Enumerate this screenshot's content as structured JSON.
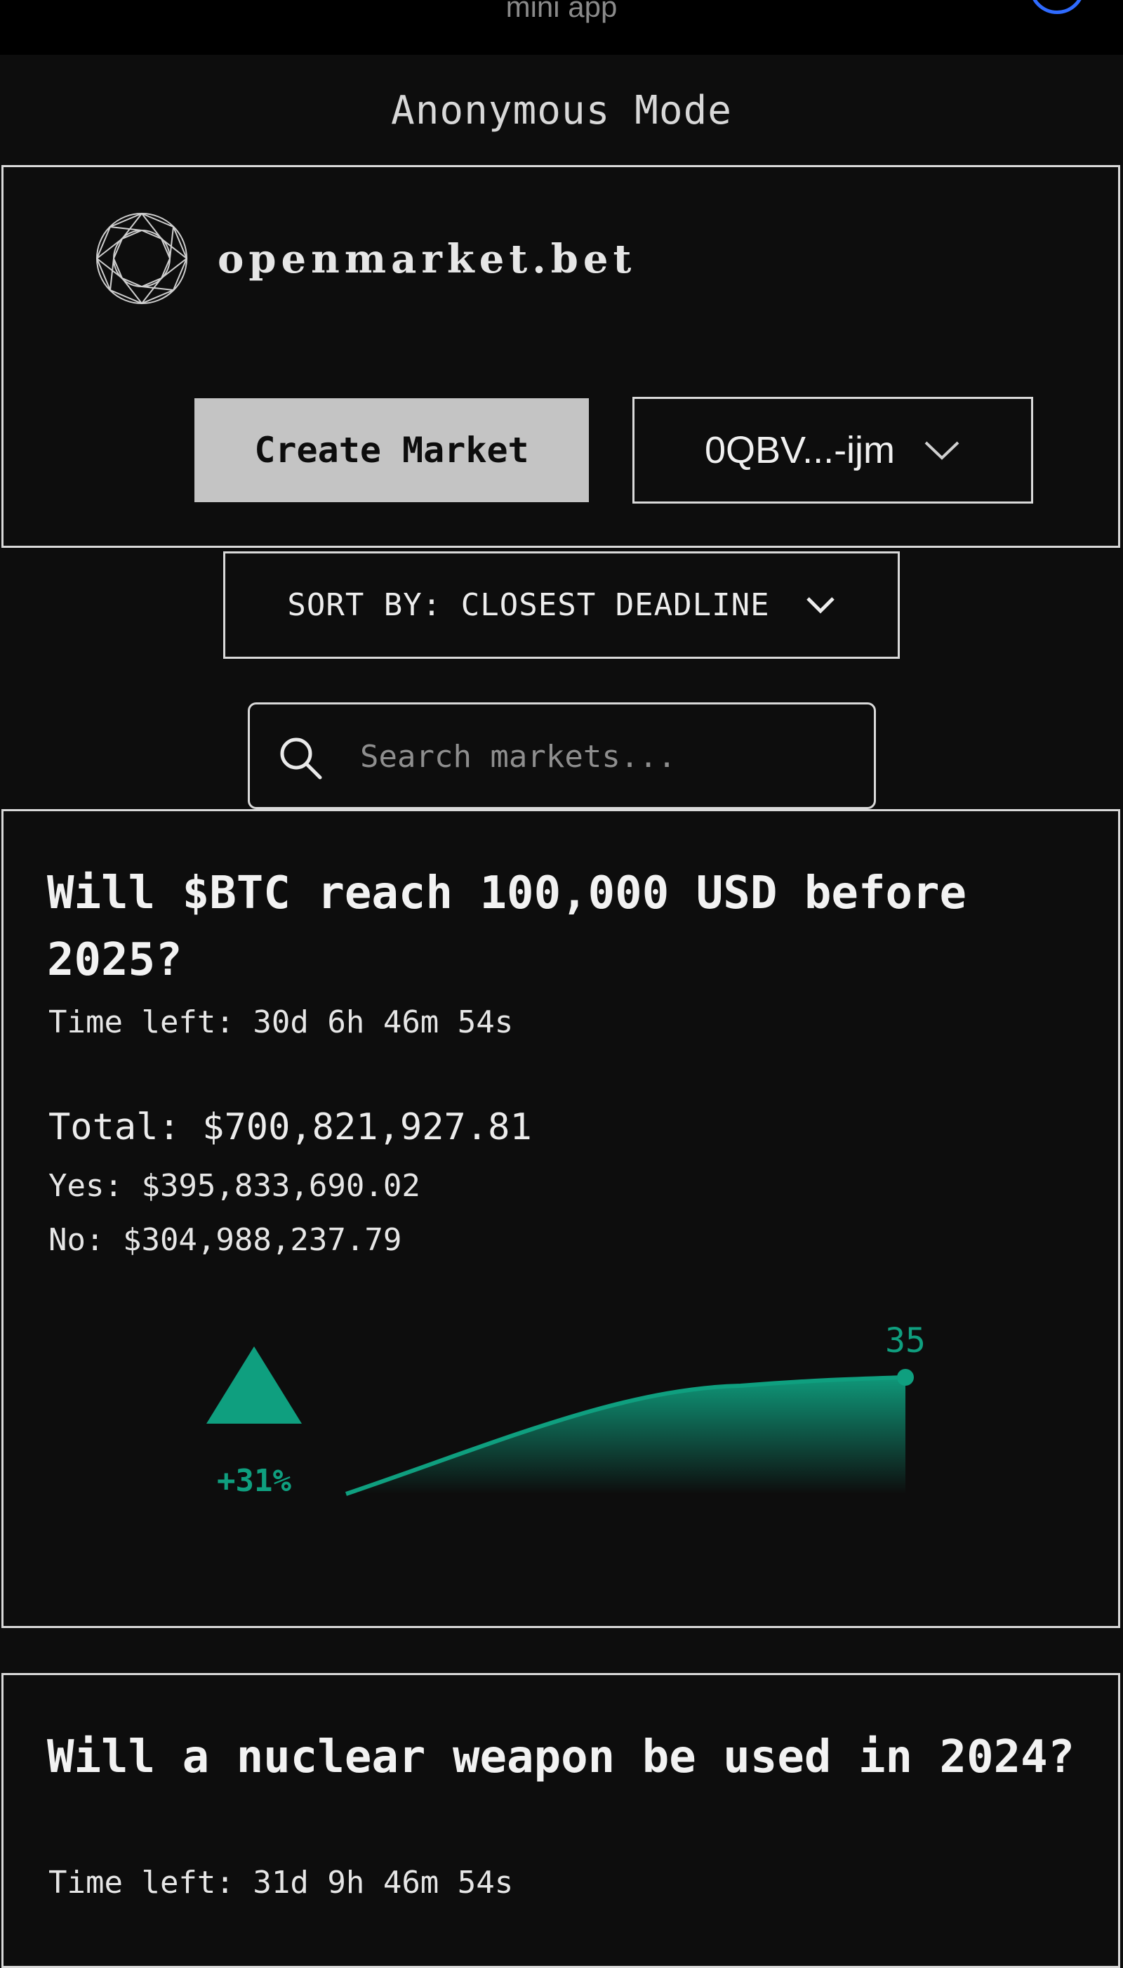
{
  "statusbar": {
    "label": "mini app"
  },
  "banner": {
    "mode": "Anonymous Mode"
  },
  "header": {
    "brand": "openmarket.bet",
    "create_button": "Create Market",
    "wallet": "0QBV...-ijm"
  },
  "sort": {
    "label": "SORT BY: CLOSEST DEADLINE"
  },
  "search": {
    "placeholder": "Search markets..."
  },
  "colors": {
    "accent": "#0f9f7f",
    "background": "#0d0d0d",
    "button": "#c4c4c4"
  },
  "markets": [
    {
      "question": "Will $BTC reach 100,000 USD before 2025?",
      "time_left": "Time left: 30d 6h 46m 54s",
      "total": "Total: $700,821,927.81",
      "yes": "Yes: $395,833,690.02",
      "no": "No: $304,988,237.79",
      "change": "+31%",
      "current": "35",
      "trend_icon": "up-triangle-icon"
    },
    {
      "question": "Will a nuclear weapon be used in 2024?",
      "time_left": "Time left: 31d 9h 46m 54s"
    }
  ]
}
